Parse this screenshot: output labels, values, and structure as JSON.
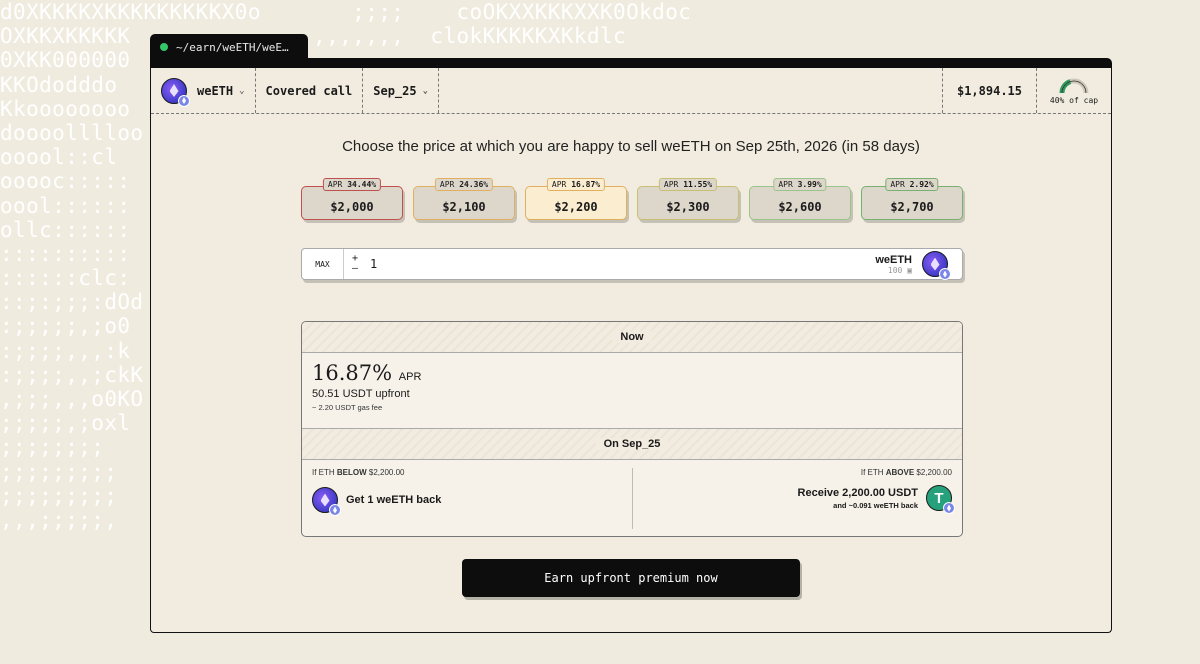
{
  "background_ascii": [
    "d0XKKKKXKKKKKKKKKX0o       ;;;;    coOKXXKKKXXK0Okdoc",
    "OXKKXKKKKK              ,,,,,,,  clokKKKKKXKkdlc",
    "0XKK000000                                        ",
    "KKOdodddo                                      ::lo",
    "Kkoooooooo                                     ::;,",
    "doooolllloo                                    ::;,",
    "ooool::cl                                      ::;,",
    "ooooc:::::                                     okOkkl",
    "oool::::::                                     ckKXKK",
    "ollc::::::                                     lOKKXK",
    "::::::::::                                     :KK000l",
    "::::::clc:                                     kddddd",
    "::;:;;;:dOd                                    ooooool",
    ":;;;;;,;o0                                     :oooooo",
    ":;;;;,,,:k                                     ooooooo",
    ":;;;;,,;ckK                                    ::oooooo",
    ",;;;,,,o0KO                                    ooooooo",
    ";;;;;,;oxl                                     :ooooo",
    ";;;;;;;;                                       ::ccloo",
    ";;;;;;;;;                                      :::clo",
    ";;;;;;;;;                                      ::cloc",
    ",,,;;;;;,    :::::::clllooooooolc:::d0XKKKKXXXKKKKKKKXKKKKXXKKK00dc:::d0Ox"
  ],
  "tab": {
    "path": "~/earn/weETH/weE…"
  },
  "header": {
    "token": "weETH",
    "strategy": "Covered call",
    "expiry": "Sep_25",
    "price": "$1,894.15",
    "cap_label": "40% of cap",
    "cap_fraction": 0.4
  },
  "title": "Choose the price at which you are happy to sell weETH on Sep 25th, 2026 (in 58 days)",
  "strikes": [
    {
      "apr_label": "APR",
      "apr": "34.44%",
      "price": "$2,000",
      "color": "#c0504d"
    },
    {
      "apr_label": "APR",
      "apr": "24.36%",
      "price": "$2,100",
      "color": "#e0b060"
    },
    {
      "apr_label": "APR",
      "apr": "16.87%",
      "price": "$2,200",
      "color": "#e0b060"
    },
    {
      "apr_label": "APR",
      "apr": "11.55%",
      "price": "$2,300",
      "color": "#c8c070"
    },
    {
      "apr_label": "APR",
      "apr": "3.99%",
      "price": "$2,600",
      "color": "#9bc48a"
    },
    {
      "apr_label": "APR",
      "apr": "2.92%",
      "price": "$2,700",
      "color": "#78b070"
    }
  ],
  "selected_strike": 2,
  "amount": {
    "max_label": "MAX",
    "plus": "+",
    "minus": "–",
    "value": "1",
    "token": "weETH",
    "balance": "100"
  },
  "summary": {
    "now_label": "Now",
    "apr_value": "16.87%",
    "apr_label": "APR",
    "upfront": "50.51 USDT upfront",
    "gas": "~ 2.20 USDT gas fee",
    "on_label": "On Sep_25",
    "below": {
      "cond_prefix": "If ETH ",
      "cond_keyword": "BELOW",
      "cond_value": " $2,200.00",
      "result": "Get 1 weETH back"
    },
    "above": {
      "cond_prefix": "If ETH ",
      "cond_keyword": "ABOVE",
      "cond_value": " $2,200.00",
      "result": "Receive 2,200.00 USDT",
      "sub": "and ~0.091 weETH back",
      "icon_glyph": "T"
    }
  },
  "cta": "Earn upfront premium now"
}
